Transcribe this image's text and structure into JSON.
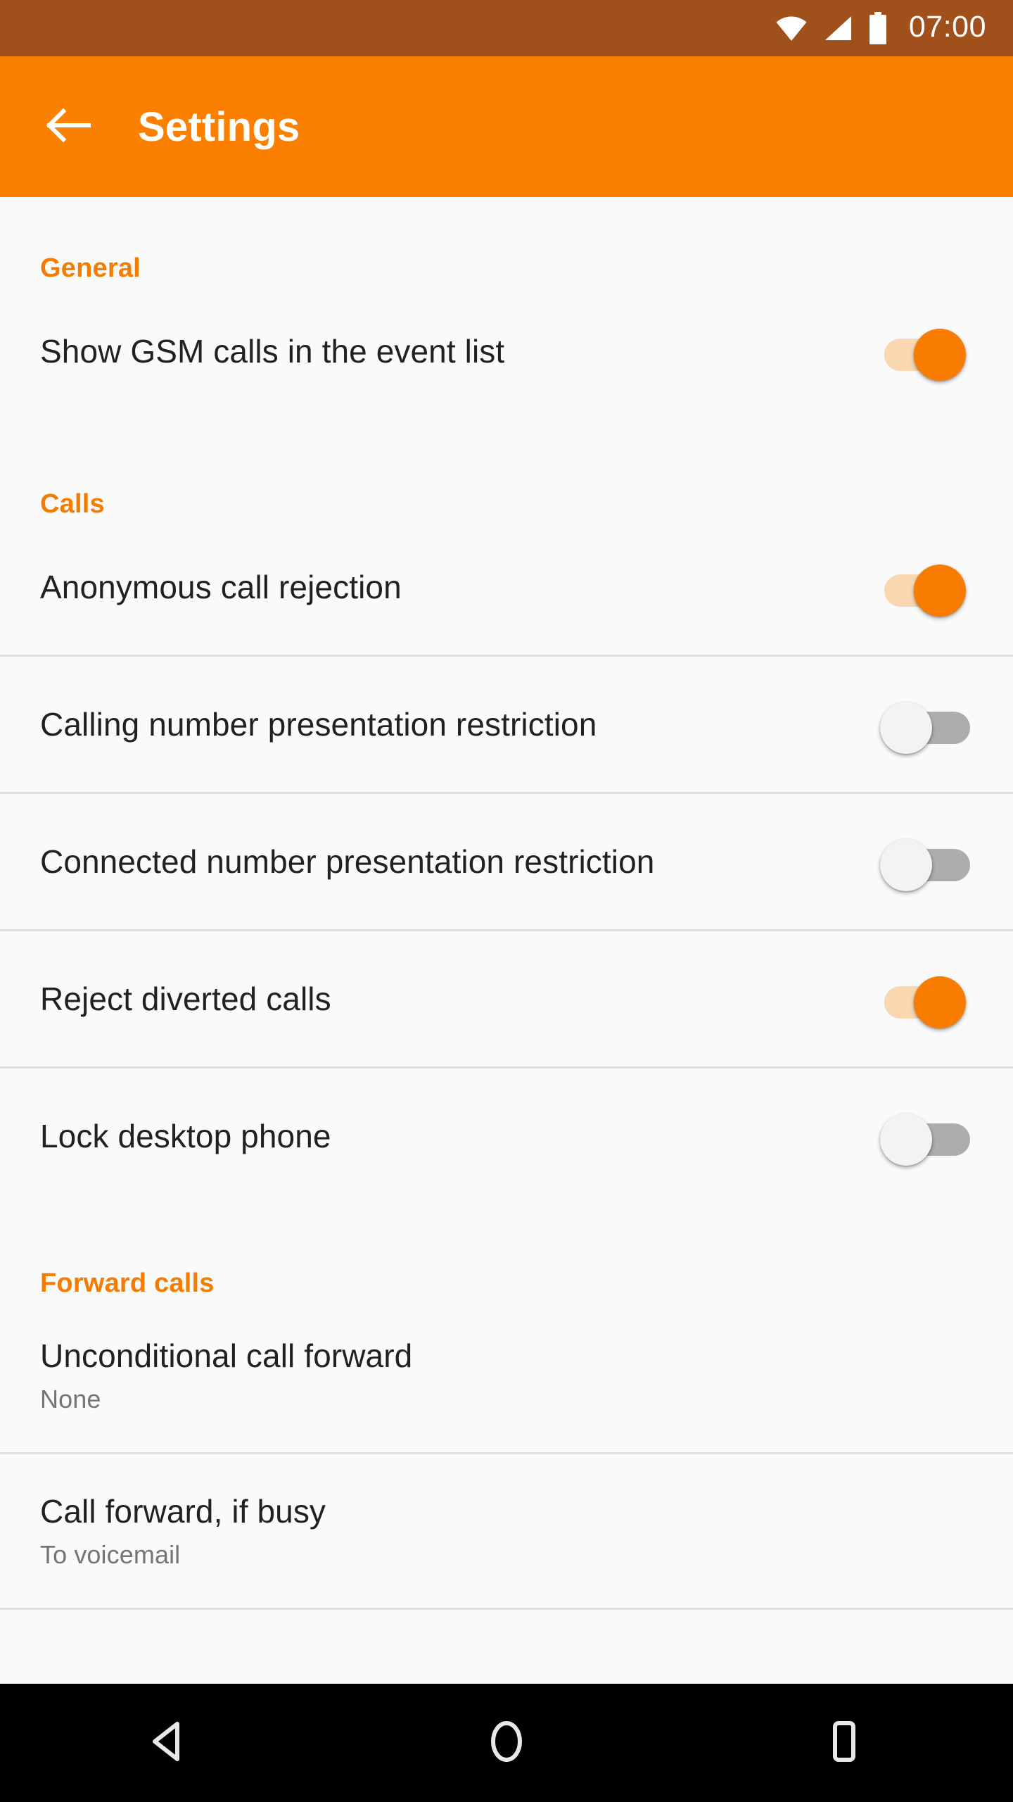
{
  "status_bar": {
    "time": "07:00",
    "icons": [
      "wifi-icon",
      "cellular-signal-icon",
      "battery-full-icon"
    ],
    "background_color": "#A0501B"
  },
  "app_bar": {
    "title": "Settings",
    "back_icon": "arrow-left-icon",
    "background_color": "#FB8000",
    "text_color": "#FFFFFF"
  },
  "theme": {
    "accent_color": "#F57C00",
    "page_background": "#FAFAFA",
    "title_text_color": "#212121",
    "subtitle_text_color": "#757575",
    "divider_color": "#E0E0E0",
    "switch_on_track": "#F9D7B0",
    "switch_on_thumb": "#F77C00",
    "switch_off_track": "#ADADAD",
    "switch_off_thumb": "#F3F3F3"
  },
  "sections": [
    {
      "header": "General",
      "rows": [
        {
          "title": "Show GSM calls in the event list",
          "type": "switch",
          "state": "on",
          "state_label": "On"
        }
      ]
    },
    {
      "header": "Calls",
      "rows": [
        {
          "title": "Anonymous call rejection",
          "type": "switch",
          "state": "on",
          "state_label": "On"
        },
        {
          "title": "Calling number presentation restriction",
          "type": "switch",
          "state": "off",
          "state_label": "Off"
        },
        {
          "title": "Connected number presentation restriction",
          "type": "switch",
          "state": "off",
          "state_label": "Off"
        },
        {
          "title": "Reject diverted calls",
          "type": "switch",
          "state": "on",
          "state_label": "On"
        },
        {
          "title": "Lock desktop phone",
          "type": "switch",
          "state": "off",
          "state_label": "Off"
        }
      ]
    },
    {
      "header": "Forward calls",
      "rows": [
        {
          "title": "Unconditional call forward",
          "type": "value",
          "subtitle": "None"
        },
        {
          "title": "Call forward, if busy",
          "type": "value",
          "subtitle": "To voicemail"
        }
      ]
    }
  ],
  "nav_bar": {
    "background_color": "#000000",
    "buttons": [
      {
        "name": "back-nav-button",
        "icon": "triangle-back-icon"
      },
      {
        "name": "home-nav-button",
        "icon": "circle-home-icon"
      },
      {
        "name": "recents-nav-button",
        "icon": "square-recents-icon"
      }
    ]
  }
}
